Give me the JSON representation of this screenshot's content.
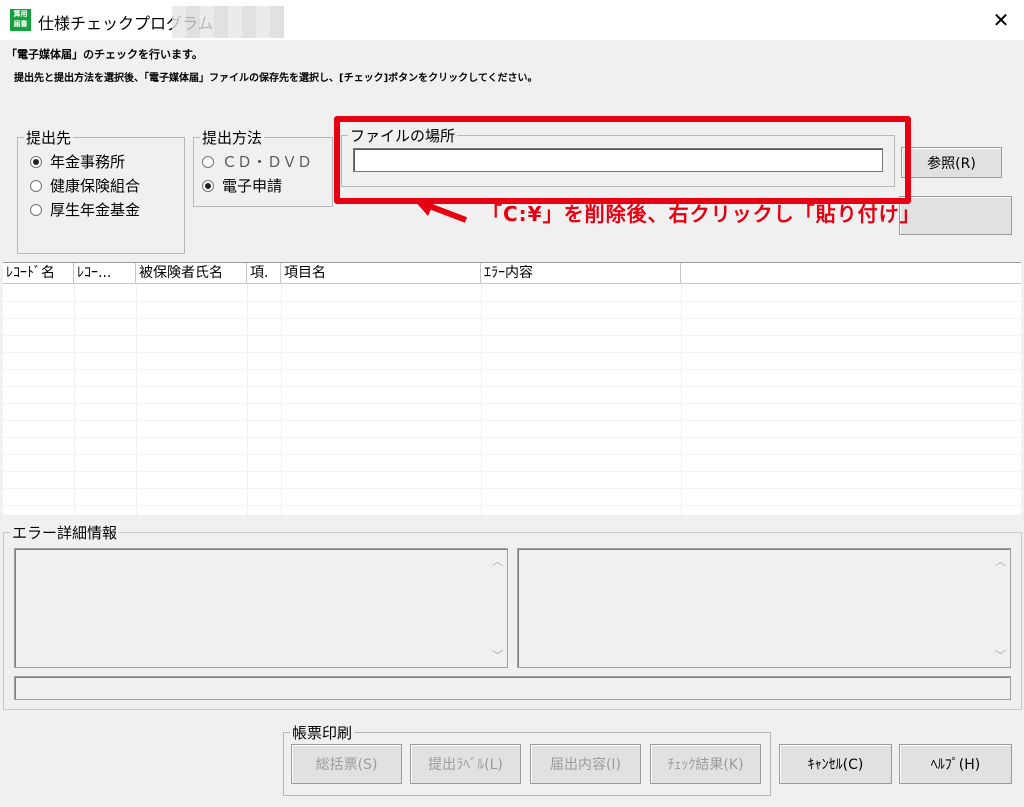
{
  "window": {
    "title": "仕様チェックプログラム",
    "icon_text": "算用\n届書",
    "close_glyph": "✕"
  },
  "messages": {
    "line1": "「電子媒体届」のチェックを行います。",
    "line2": "提出先と提出方法を選択後、「電子媒体届」ファイルの保存先を選択し、[チェック]ボタンをクリックしてください。"
  },
  "submit_to": {
    "legend": "提出先",
    "options": [
      {
        "label": "年金事務所",
        "selected": true
      },
      {
        "label": "健康保険組合",
        "selected": false
      },
      {
        "label": "厚生年金基金",
        "selected": false
      }
    ]
  },
  "submit_method": {
    "legend": "提出方法",
    "options": [
      {
        "label": "ＣＤ・ＤＶＤ",
        "selected": false
      },
      {
        "label": "電子申請",
        "selected": true
      }
    ]
  },
  "file_location": {
    "legend": "ファイルの場所",
    "value": "",
    "placeholder": ""
  },
  "browse_button": "参照(R)",
  "annotation": "「C:¥」を削除後、右クリックし「貼り付け」",
  "annotation_color": "#e60012",
  "table": {
    "columns": [
      "ﾚｺｰﾄﾞ名",
      "ﾚｺｰ...",
      "被保険者氏名",
      "項.",
      "項目名",
      "ｴﾗｰ内容"
    ],
    "rows": []
  },
  "error_detail": {
    "legend": "エラー詳細情報"
  },
  "print_group": {
    "legend": "帳票印刷",
    "buttons": [
      "総括票(S)",
      "提出ﾗﾍﾞﾙ(L)",
      "届出内容(I)",
      "ﾁｪｯｸ結果(K)"
    ]
  },
  "cancel_button": "ｷｬﾝｾﾙ(C)",
  "help_button": "ﾍﾙﾌﾟ(H)"
}
